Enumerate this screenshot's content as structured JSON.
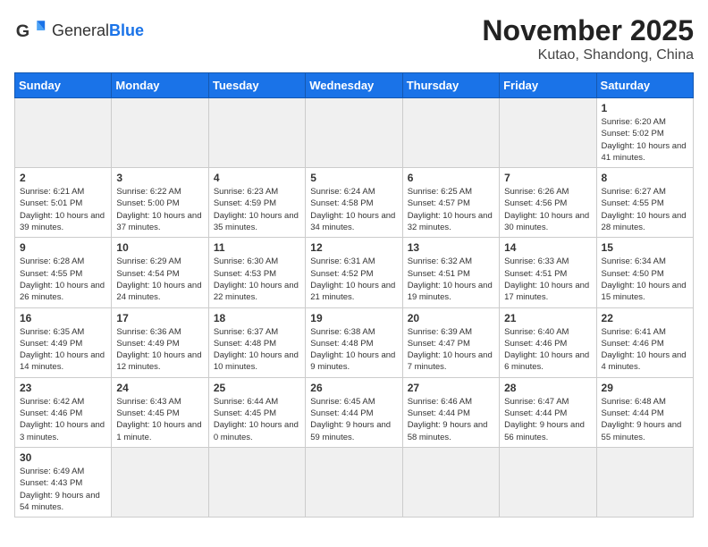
{
  "header": {
    "logo_general": "General",
    "logo_blue": "Blue",
    "month": "November 2025",
    "location": "Kutao, Shandong, China"
  },
  "weekdays": [
    "Sunday",
    "Monday",
    "Tuesday",
    "Wednesday",
    "Thursday",
    "Friday",
    "Saturday"
  ],
  "weeks": [
    [
      {
        "day": "",
        "empty": true
      },
      {
        "day": "",
        "empty": true
      },
      {
        "day": "",
        "empty": true
      },
      {
        "day": "",
        "empty": true
      },
      {
        "day": "",
        "empty": true
      },
      {
        "day": "",
        "empty": true
      },
      {
        "day": "1",
        "sunrise": "6:20 AM",
        "sunset": "5:02 PM",
        "daylight": "10 hours and 41 minutes."
      }
    ],
    [
      {
        "day": "2",
        "sunrise": "6:21 AM",
        "sunset": "5:01 PM",
        "daylight": "10 hours and 39 minutes."
      },
      {
        "day": "3",
        "sunrise": "6:22 AM",
        "sunset": "5:00 PM",
        "daylight": "10 hours and 37 minutes."
      },
      {
        "day": "4",
        "sunrise": "6:23 AM",
        "sunset": "4:59 PM",
        "daylight": "10 hours and 35 minutes."
      },
      {
        "day": "5",
        "sunrise": "6:24 AM",
        "sunset": "4:58 PM",
        "daylight": "10 hours and 34 minutes."
      },
      {
        "day": "6",
        "sunrise": "6:25 AM",
        "sunset": "4:57 PM",
        "daylight": "10 hours and 32 minutes."
      },
      {
        "day": "7",
        "sunrise": "6:26 AM",
        "sunset": "4:56 PM",
        "daylight": "10 hours and 30 minutes."
      },
      {
        "day": "8",
        "sunrise": "6:27 AM",
        "sunset": "4:55 PM",
        "daylight": "10 hours and 28 minutes."
      }
    ],
    [
      {
        "day": "9",
        "sunrise": "6:28 AM",
        "sunset": "4:55 PM",
        "daylight": "10 hours and 26 minutes."
      },
      {
        "day": "10",
        "sunrise": "6:29 AM",
        "sunset": "4:54 PM",
        "daylight": "10 hours and 24 minutes."
      },
      {
        "day": "11",
        "sunrise": "6:30 AM",
        "sunset": "4:53 PM",
        "daylight": "10 hours and 22 minutes."
      },
      {
        "day": "12",
        "sunrise": "6:31 AM",
        "sunset": "4:52 PM",
        "daylight": "10 hours and 21 minutes."
      },
      {
        "day": "13",
        "sunrise": "6:32 AM",
        "sunset": "4:51 PM",
        "daylight": "10 hours and 19 minutes."
      },
      {
        "day": "14",
        "sunrise": "6:33 AM",
        "sunset": "4:51 PM",
        "daylight": "10 hours and 17 minutes."
      },
      {
        "day": "15",
        "sunrise": "6:34 AM",
        "sunset": "4:50 PM",
        "daylight": "10 hours and 15 minutes."
      }
    ],
    [
      {
        "day": "16",
        "sunrise": "6:35 AM",
        "sunset": "4:49 PM",
        "daylight": "10 hours and 14 minutes."
      },
      {
        "day": "17",
        "sunrise": "6:36 AM",
        "sunset": "4:49 PM",
        "daylight": "10 hours and 12 minutes."
      },
      {
        "day": "18",
        "sunrise": "6:37 AM",
        "sunset": "4:48 PM",
        "daylight": "10 hours and 10 minutes."
      },
      {
        "day": "19",
        "sunrise": "6:38 AM",
        "sunset": "4:48 PM",
        "daylight": "10 hours and 9 minutes."
      },
      {
        "day": "20",
        "sunrise": "6:39 AM",
        "sunset": "4:47 PM",
        "daylight": "10 hours and 7 minutes."
      },
      {
        "day": "21",
        "sunrise": "6:40 AM",
        "sunset": "4:46 PM",
        "daylight": "10 hours and 6 minutes."
      },
      {
        "day": "22",
        "sunrise": "6:41 AM",
        "sunset": "4:46 PM",
        "daylight": "10 hours and 4 minutes."
      }
    ],
    [
      {
        "day": "23",
        "sunrise": "6:42 AM",
        "sunset": "4:46 PM",
        "daylight": "10 hours and 3 minutes."
      },
      {
        "day": "24",
        "sunrise": "6:43 AM",
        "sunset": "4:45 PM",
        "daylight": "10 hours and 1 minute."
      },
      {
        "day": "25",
        "sunrise": "6:44 AM",
        "sunset": "4:45 PM",
        "daylight": "10 hours and 0 minutes."
      },
      {
        "day": "26",
        "sunrise": "6:45 AM",
        "sunset": "4:44 PM",
        "daylight": "9 hours and 59 minutes."
      },
      {
        "day": "27",
        "sunrise": "6:46 AM",
        "sunset": "4:44 PM",
        "daylight": "9 hours and 58 minutes."
      },
      {
        "day": "28",
        "sunrise": "6:47 AM",
        "sunset": "4:44 PM",
        "daylight": "9 hours and 56 minutes."
      },
      {
        "day": "29",
        "sunrise": "6:48 AM",
        "sunset": "4:44 PM",
        "daylight": "9 hours and 55 minutes."
      }
    ],
    [
      {
        "day": "30",
        "sunrise": "6:49 AM",
        "sunset": "4:43 PM",
        "daylight": "9 hours and 54 minutes."
      },
      {
        "day": "",
        "empty": true
      },
      {
        "day": "",
        "empty": true
      },
      {
        "day": "",
        "empty": true
      },
      {
        "day": "",
        "empty": true
      },
      {
        "day": "",
        "empty": true
      },
      {
        "day": "",
        "empty": true
      }
    ]
  ]
}
